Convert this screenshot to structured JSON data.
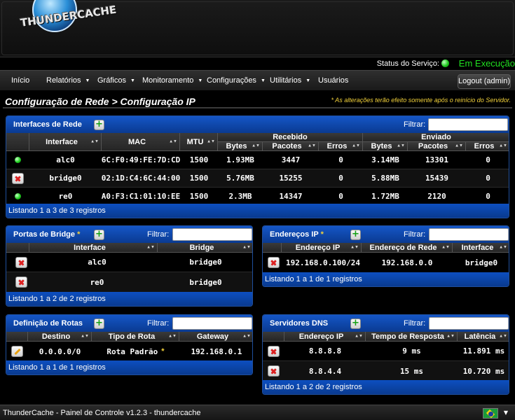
{
  "header": {
    "logo_text": "THUNDERCACHE"
  },
  "status": {
    "label": "Status do Serviço:",
    "value": "Em Execução",
    "color": "#21e021"
  },
  "nav": {
    "items": [
      {
        "label": "Início",
        "caret": false
      },
      {
        "label": "Relatórios",
        "caret": true
      },
      {
        "label": "Gráficos",
        "caret": true
      },
      {
        "label": "Monitoramento",
        "caret": true
      },
      {
        "label": "Configurações",
        "caret": true
      },
      {
        "label": "Utilitários",
        "caret": true
      },
      {
        "label": "Usuários",
        "caret": false
      }
    ],
    "logout": "Logout (admin)"
  },
  "page": {
    "title": "Configuração de Rede > Configuração IP",
    "notice": "* As alterações terão efeito somente após o reinício do Servidor."
  },
  "common": {
    "filter_label": "Filtrar:",
    "caret_glyph": "▼",
    "sort_glyph": "▲▼",
    "add_glyph": "+"
  },
  "interfaces": {
    "title": "Interfaces de Rede",
    "group_received": "Recebido",
    "group_sent": "Enviado",
    "columns": [
      "Interface",
      "MAC",
      "MTU",
      "Bytes",
      "Pacotes",
      "Erros",
      "Bytes",
      "Pacotes",
      "Erros"
    ],
    "rows": [
      {
        "status": "up",
        "interface": "alc0",
        "mac": "6C:F0:49:FE:7D:CD",
        "mtu": "1500",
        "rx_bytes": "1.93MB",
        "rx_packets": "3447",
        "rx_errors": "0",
        "tx_bytes": "3.14MB",
        "tx_packets": "13301",
        "tx_errors": "0"
      },
      {
        "status": "down",
        "interface": "bridge0",
        "mac": "02:1D:C4:6C:44:00",
        "mtu": "1500",
        "rx_bytes": "5.76MB",
        "rx_packets": "15255",
        "rx_errors": "0",
        "tx_bytes": "5.88MB",
        "tx_packets": "15439",
        "tx_errors": "0"
      },
      {
        "status": "up",
        "interface": "re0",
        "mac": "A0:F3:C1:01:10:EE",
        "mtu": "1500",
        "rx_bytes": "2.3MB",
        "rx_packets": "14347",
        "rx_errors": "0",
        "tx_bytes": "1.72MB",
        "tx_packets": "2120",
        "tx_errors": "0"
      }
    ],
    "footer": "Listando 1 a 3 de 3 registros"
  },
  "bridge_ports": {
    "title": "Portas de Bridge",
    "star": "*",
    "columns": [
      "Interface",
      "Bridge"
    ],
    "rows": [
      {
        "interface": "alc0",
        "bridge": "bridge0"
      },
      {
        "interface": "re0",
        "bridge": "bridge0"
      }
    ],
    "footer": "Listando 1 a 2 de 2 registros"
  },
  "ip_addresses": {
    "title": "Endereços IP",
    "star": "*",
    "columns": [
      "Endereço IP",
      "Endereço de Rede",
      "Interface"
    ],
    "rows": [
      {
        "ip": "192.168.0.100/24",
        "network": "192.168.0.0",
        "interface": "bridge0"
      }
    ],
    "footer": "Listando 1 a 1 de 1 registros"
  },
  "routes": {
    "title": "Definição de Rotas",
    "columns": [
      "Destino",
      "Tipo de Rota",
      "Gateway"
    ],
    "rows": [
      {
        "destination": "0.0.0.0/0",
        "type": "Rota Padrão",
        "star": "*",
        "gateway": "192.168.0.1"
      }
    ],
    "footer": "Listando 1 a 1 de 1 registros"
  },
  "dns": {
    "title": "Servidores DNS",
    "columns": [
      "Endereço IP",
      "Tempo de Resposta",
      "Latência"
    ],
    "rows": [
      {
        "ip": "8.8.8.8",
        "response": "9 ms",
        "latency": "11.891 ms"
      },
      {
        "ip": "8.8.4.4",
        "response": "15 ms",
        "latency": "10.720 ms"
      }
    ],
    "footer": "Listando 1 a 2 de 2 registros"
  },
  "footer": {
    "text": "ThunderCache - Painel de Controle v1.2.3 - thundercache",
    "flag": "brazil-flag"
  }
}
